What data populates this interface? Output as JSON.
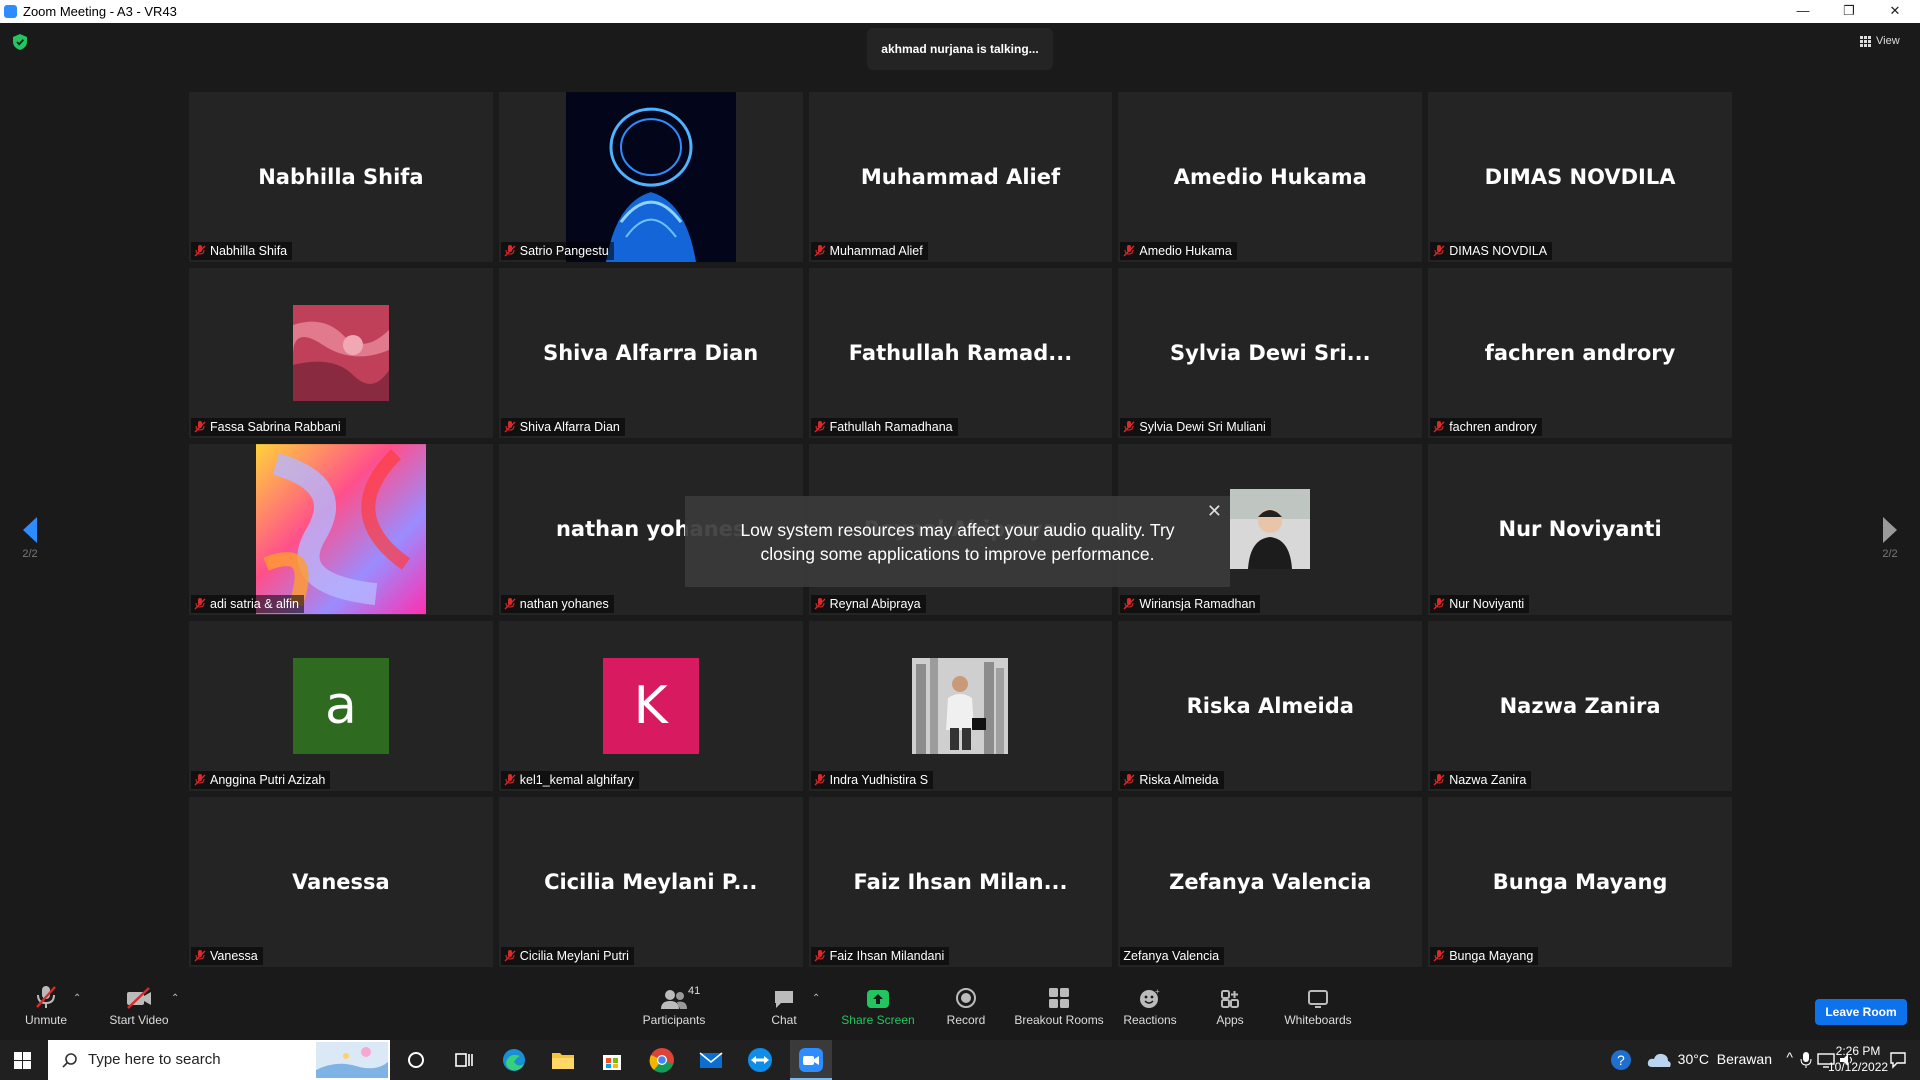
{
  "window": {
    "title": "Zoom Meeting - A3 - VR43",
    "minimize": "—",
    "restore": "❐",
    "close": "✕"
  },
  "meeting": {
    "talking": "akhmad nurjana is talking...",
    "view_label": "View",
    "page_left": "2/2",
    "page_right": "2/2",
    "notice": {
      "line1": "Low system resources may affect your audio quality. Try",
      "line2": "closing some applications to improve performance."
    }
  },
  "tiles": [
    {
      "center": "Nabhilla Shifa",
      "label": "Nabhilla Shifa"
    },
    {
      "center": "",
      "label": "Satrio Pangestu"
    },
    {
      "center": "Muhammad Alief",
      "label": "Muhammad Alief"
    },
    {
      "center": "Amedio Hukama",
      "label": "Amedio Hukama"
    },
    {
      "center": "DIMAS NOVDILA",
      "label": "DIMAS NOVDILA"
    },
    {
      "center": "",
      "label": "Fassa Sabrina Rabbani"
    },
    {
      "center": "Shiva Alfarra Dian",
      "label": "Shiva Alfarra Dian"
    },
    {
      "center": "Fathullah  Ramad...",
      "label": "Fathullah Ramadhana"
    },
    {
      "center": "Sylvia  Dewi  Sri...",
      "label": "Sylvia Dewi Sri Muliani"
    },
    {
      "center": "fachren androry",
      "label": "fachren androry"
    },
    {
      "center": "",
      "label": "adi satria & alfin"
    },
    {
      "center": "nathan yohanes",
      "label": "nathan yohanes"
    },
    {
      "center": "Reynal Abipraya",
      "label": "Reynal Abipraya"
    },
    {
      "center": "",
      "label": "Wiriansja Ramadhan"
    },
    {
      "center": "Nur Noviyanti",
      "label": "Nur Noviyanti"
    },
    {
      "center": "a",
      "label": "Anggina Putri Azizah"
    },
    {
      "center": "K",
      "label": "kel1_kemal alghifary"
    },
    {
      "center": "",
      "label": "Indra Yudhistira S"
    },
    {
      "center": "Riska Almeida",
      "label": "Riska Almeida"
    },
    {
      "center": "Nazwa Zanira",
      "label": "Nazwa Zanira"
    },
    {
      "center": "Vanessa",
      "label": "Vanessa"
    },
    {
      "center": "Cicilia  Meylani  P...",
      "label": "Cicilia Meylani Putri"
    },
    {
      "center": "Faiz  Ihsan  Milan...",
      "label": "Faiz Ihsan Milandani"
    },
    {
      "center": "Zefanya Valencia",
      "label": "Zefanya Valencia"
    },
    {
      "center": "Bunga Mayang",
      "label": "Bunga Mayang"
    }
  ],
  "toolbar": {
    "unmute": "Unmute",
    "start_video": "Start Video",
    "participants": "Participants",
    "participants_count": "41",
    "chat": "Chat",
    "share_screen": "Share Screen",
    "record": "Record",
    "breakout": "Breakout Rooms",
    "reactions": "Reactions",
    "apps": "Apps",
    "whiteboards": "Whiteboards",
    "leave": "Leave Room"
  },
  "taskbar": {
    "search_placeholder": "Type here to search",
    "weather": "30°C  Berawan",
    "time": "2:26 PM",
    "date": "10/12/2022"
  },
  "colors": {
    "avatar_a": "#2e6b21",
    "avatar_k": "#d81b60",
    "accent": "#0e72ed",
    "share": "#22c55e"
  }
}
